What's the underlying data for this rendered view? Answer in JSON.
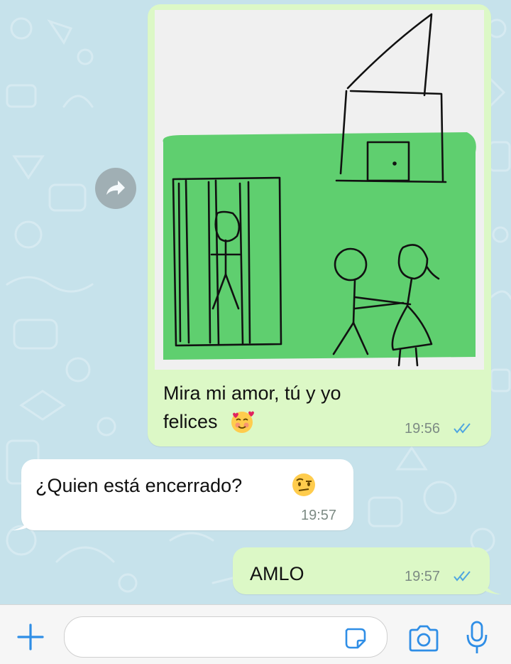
{
  "messages": [
    {
      "direction": "outgoing",
      "type": "image",
      "caption": "Mira mi amor, tú y yo felices",
      "caption_line1": "Mira mi amor, tú y yo",
      "caption_line2": "felices",
      "caption_emoji": "smiling-face-with-hearts",
      "time": "19:56",
      "status": "read"
    },
    {
      "direction": "incoming",
      "type": "text",
      "text": "¿Quien está encerrado?",
      "emoji": "face-with-raised-eyebrow",
      "time": "19:57"
    },
    {
      "direction": "outgoing",
      "type": "text",
      "text": "AMLO",
      "time": "19:57",
      "status": "read"
    }
  ],
  "composer": {
    "placeholder": "",
    "icons": [
      "plus-icon",
      "sticker-icon",
      "camera-icon",
      "microphone-icon"
    ]
  },
  "colors": {
    "outgoing_bubble": "#dcf8c6",
    "incoming_bubble": "#ffffff",
    "read_ticks": "#4fa6e0",
    "drawing_green": "#5fcf6f"
  }
}
